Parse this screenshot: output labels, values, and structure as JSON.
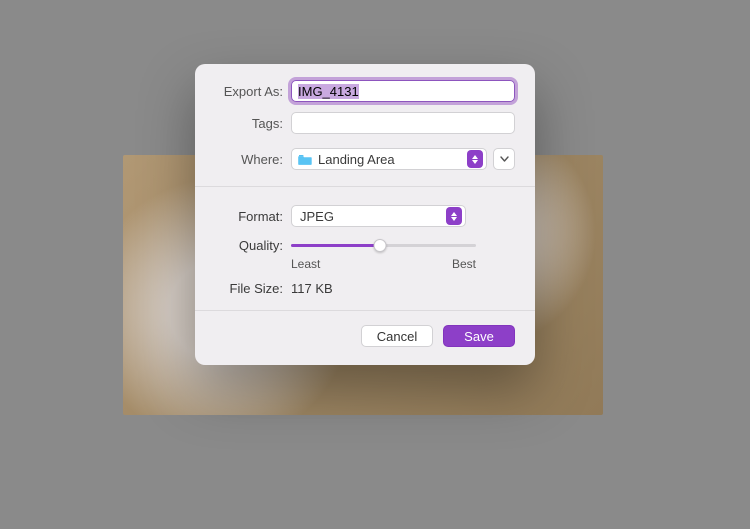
{
  "labels": {
    "export_as": "Export As:",
    "tags": "Tags:",
    "where": "Where:",
    "format": "Format:",
    "quality": "Quality:",
    "file_size": "File Size:"
  },
  "filename": "IMG_4131",
  "tags_value": "",
  "where": {
    "folder_name": "Landing Area"
  },
  "format": {
    "selected": "JPEG"
  },
  "quality": {
    "least_label": "Least",
    "best_label": "Best",
    "percent": 48
  },
  "file_size_value": "117 KB",
  "buttons": {
    "cancel": "Cancel",
    "save": "Save"
  },
  "colors": {
    "accent": "#8d3fc8"
  }
}
